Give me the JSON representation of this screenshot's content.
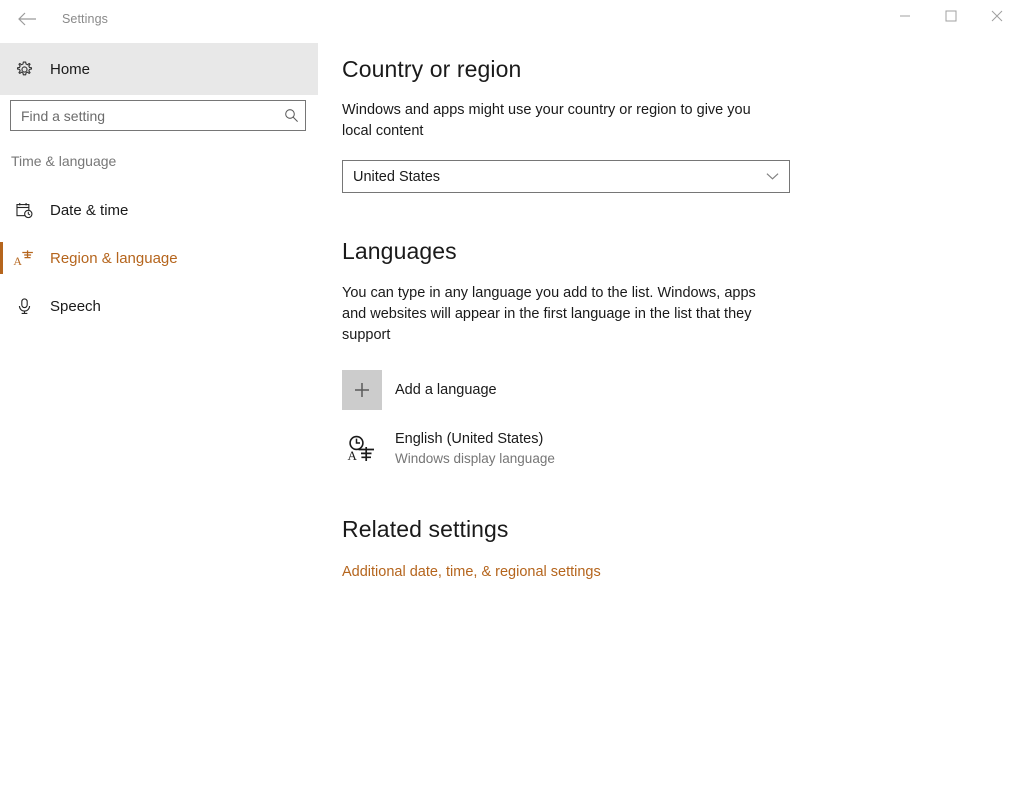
{
  "window": {
    "title": "Settings",
    "back_icon": "back-arrow-icon",
    "minimize_label": "—",
    "maximize_label": "☐",
    "close_label": "✕"
  },
  "sidebar": {
    "home": {
      "label": "Home",
      "icon": "gear-icon"
    },
    "search": {
      "value": "",
      "placeholder": "Find a setting",
      "icon": "search-icon"
    },
    "group_label": "Time & language",
    "items": [
      {
        "label": "Date & time",
        "icon": "calendar-clock-icon",
        "selected": false
      },
      {
        "label": "Region & language",
        "icon": "language-icon",
        "selected": true
      },
      {
        "label": "Speech",
        "icon": "microphone-icon",
        "selected": false
      }
    ]
  },
  "main": {
    "country": {
      "heading": "Country or region",
      "description": "Windows and apps might use your country or region to give you local content",
      "selected": "United States",
      "chevron_icon": "chevron-down-icon"
    },
    "languages": {
      "heading": "Languages",
      "description": "You can type in any language you add to the list. Windows, apps and websites will appear in the first language in the list that they support",
      "add_label": "Add a language",
      "add_icon": "plus-icon",
      "list": [
        {
          "name": "English (United States)",
          "sub": "Windows display language",
          "icon": "language-icon"
        }
      ]
    },
    "related": {
      "heading": "Related settings",
      "links": [
        {
          "label": "Additional date, time, & regional settings"
        }
      ]
    }
  },
  "colors": {
    "accent": "#b5651d",
    "text": "#1a1a1a",
    "secondary_text": "#767676",
    "home_highlight": "#e8e8e8",
    "add_square": "#cccccc"
  }
}
